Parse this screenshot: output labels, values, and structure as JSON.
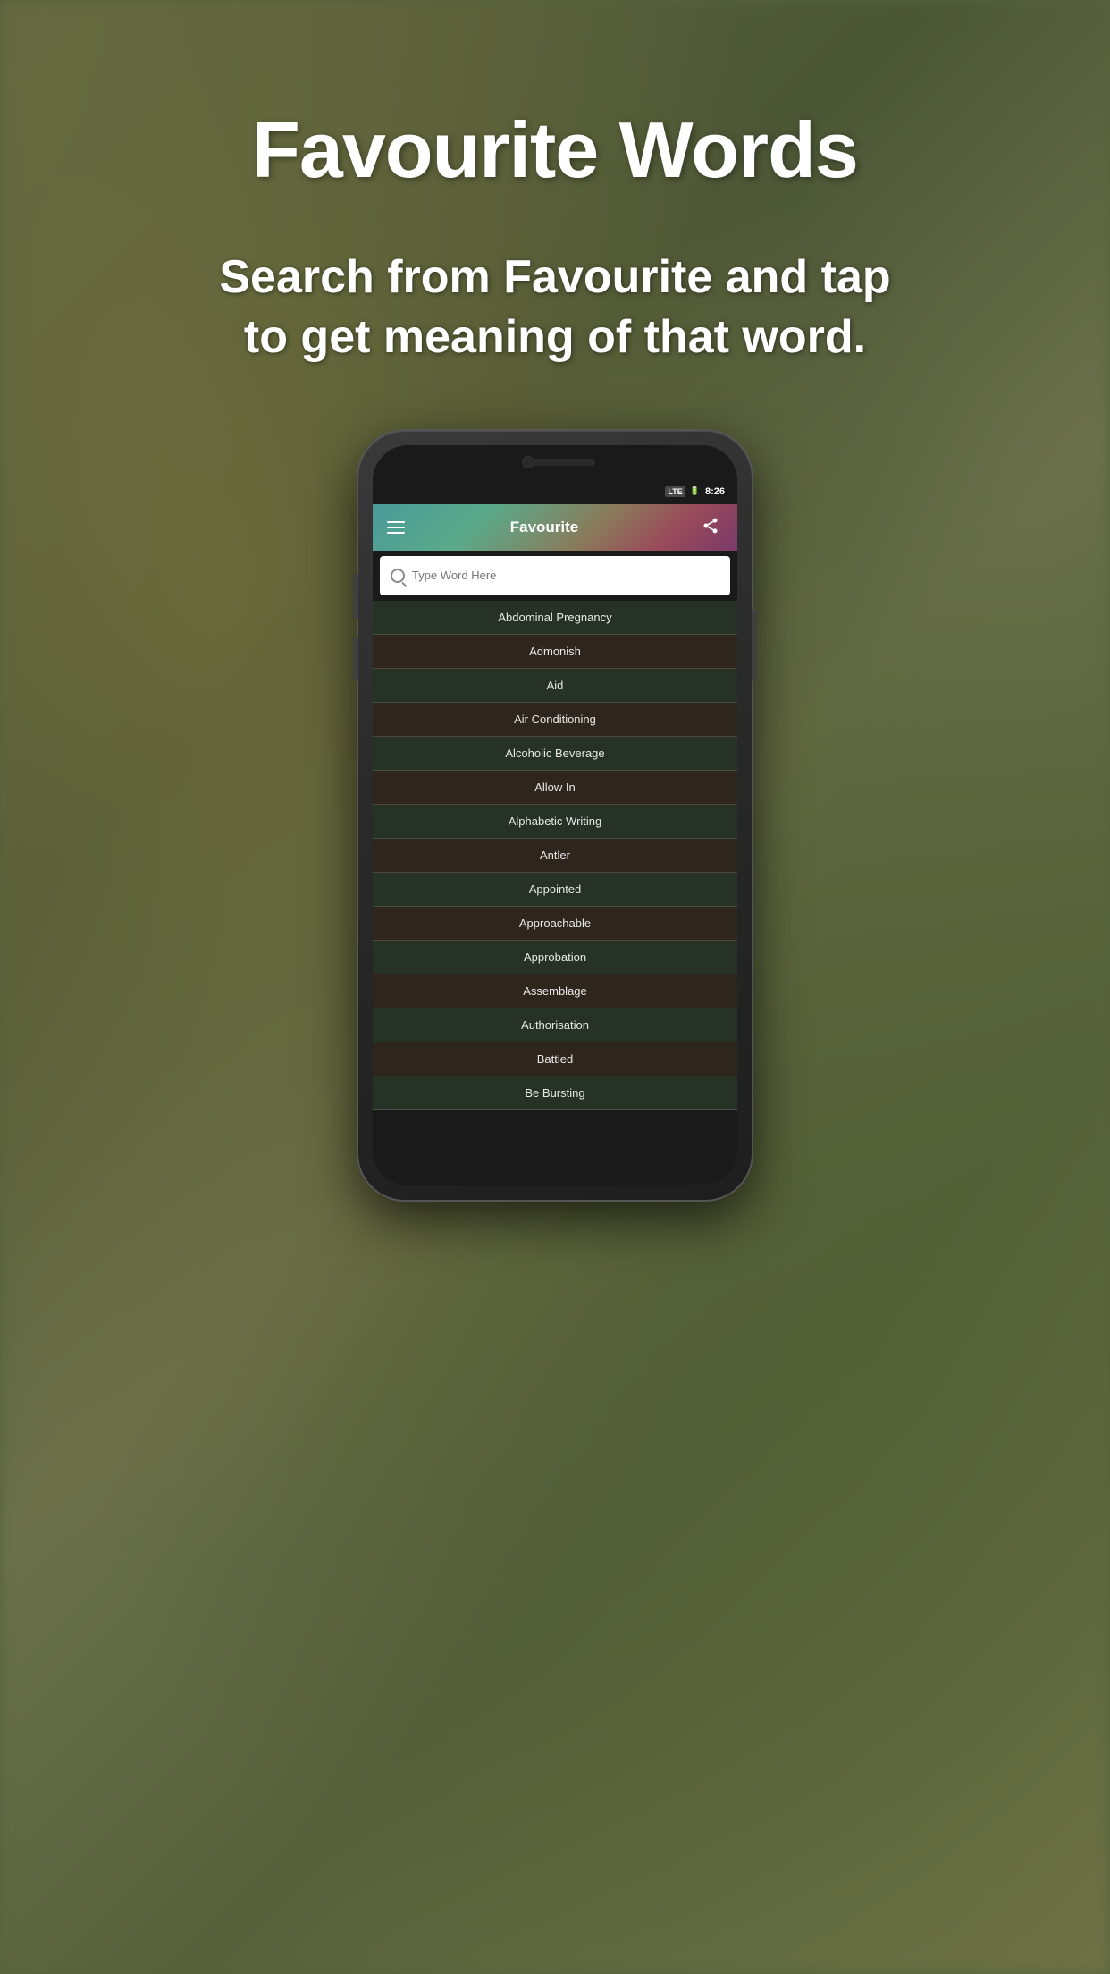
{
  "page": {
    "title": "Favourite Words",
    "subtitle": "Search from Favourite and tap to get meaning of that word."
  },
  "status_bar": {
    "time": "8:26",
    "lte": "LTE",
    "battery": "🔋"
  },
  "toolbar": {
    "title": "Favourite",
    "menu_label": "menu",
    "share_label": "share"
  },
  "search": {
    "placeholder": "Type Word Here"
  },
  "word_list": [
    {
      "id": 1,
      "word": "Abdominal Pregnancy"
    },
    {
      "id": 2,
      "word": "Admonish"
    },
    {
      "id": 3,
      "word": "Aid"
    },
    {
      "id": 4,
      "word": "Air Conditioning"
    },
    {
      "id": 5,
      "word": "Alcoholic Beverage"
    },
    {
      "id": 6,
      "word": "Allow In"
    },
    {
      "id": 7,
      "word": "Alphabetic Writing"
    },
    {
      "id": 8,
      "word": "Antler"
    },
    {
      "id": 9,
      "word": "Appointed"
    },
    {
      "id": 10,
      "word": "Approachable"
    },
    {
      "id": 11,
      "word": "Approbation"
    },
    {
      "id": 12,
      "word": "Assemblage"
    },
    {
      "id": 13,
      "word": "Authorisation"
    },
    {
      "id": 14,
      "word": "Battled"
    },
    {
      "id": 15,
      "word": "Be Bursting"
    }
  ],
  "nav": {
    "back": "back",
    "home": "home",
    "recents": "recents"
  },
  "colors": {
    "bg_start": "#7a8050",
    "bg_end": "#5a6840",
    "toolbar_start": "#4a9a9a",
    "toolbar_end": "#7a3a6a",
    "word_odd": "rgba(40,55,40,0.85)",
    "word_even": "rgba(50,40,30,0.85)",
    "text_white": "#ffffff",
    "text_word": "#e8e8e8"
  }
}
